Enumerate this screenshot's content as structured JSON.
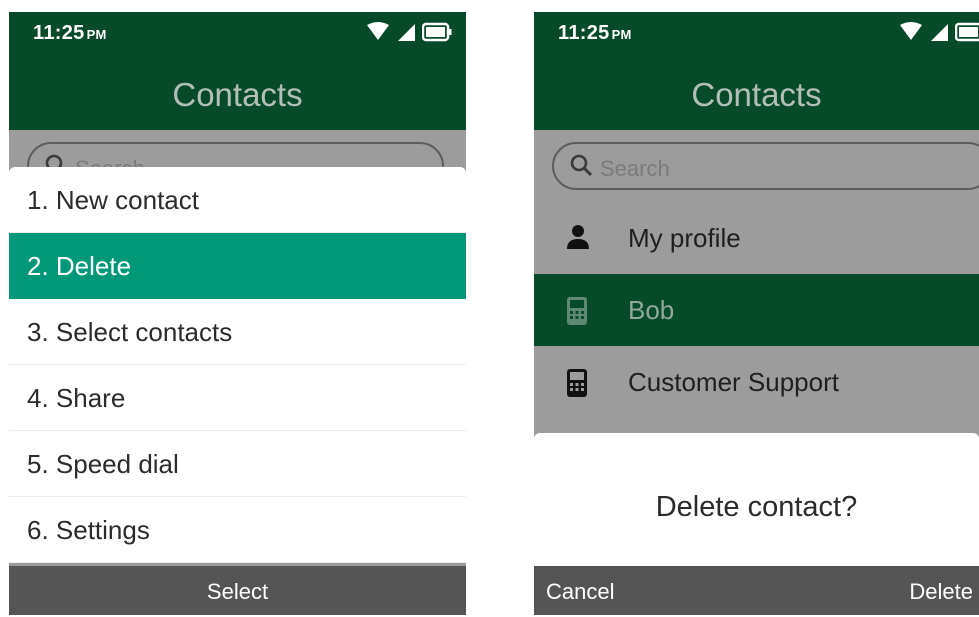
{
  "left_screen": {
    "status_time": "11:25",
    "status_ampm": "PM",
    "title": "Contacts",
    "search_placeholder": "Search",
    "menu_items": [
      {
        "label": "1. New contact",
        "selected": false
      },
      {
        "label": "2. Delete",
        "selected": true
      },
      {
        "label": "3. Select contacts",
        "selected": false
      },
      {
        "label": "4. Share",
        "selected": false
      },
      {
        "label": "5. Speed dial",
        "selected": false
      },
      {
        "label": "6. Settings",
        "selected": false
      }
    ],
    "softkey_center": "Select"
  },
  "right_screen": {
    "status_time": "11:25",
    "status_ampm": "PM",
    "title": "Contacts",
    "search_placeholder": "Search",
    "contacts": [
      {
        "name": "My profile",
        "icon": "person-icon",
        "selected": false
      },
      {
        "name": "Bob",
        "icon": "phone-icon",
        "selected": true
      },
      {
        "name": "Customer Support",
        "icon": "phone-icon",
        "selected": false
      }
    ],
    "dialog_text": "Delete contact?",
    "softkey_left": "Cancel",
    "softkey_right": "Delete"
  },
  "colors": {
    "header": "#074a2a",
    "menu_selected": "#009878",
    "softkey_bar": "#555555",
    "list_background": "#9c9c9c"
  }
}
